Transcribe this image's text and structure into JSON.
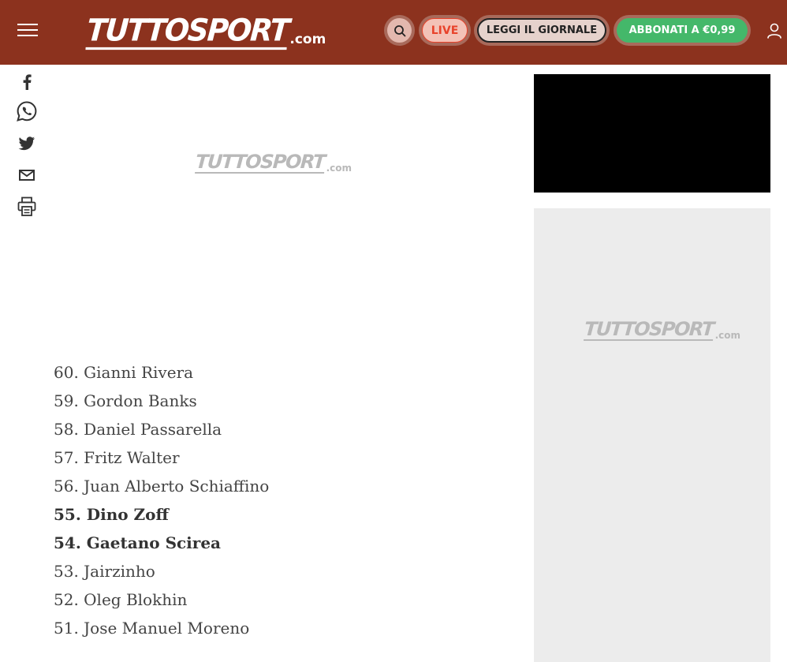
{
  "header": {
    "logo_main": "TUTTOSPORT",
    "logo_suffix": ".com",
    "live_label": "LIVE",
    "giornale_label": "LEGGI IL GIORNALE",
    "abbonati_label": "ABBONATI A €0,99"
  },
  "colors": {
    "header_bg": "#8c321e",
    "live_accent": "#e8432b",
    "subscribe_green": "#44b86a",
    "ad_background": "#ececec"
  },
  "share": {
    "icons": [
      "facebook-icon",
      "whatsapp-icon",
      "twitter-icon",
      "email-icon",
      "print-icon"
    ]
  },
  "placeholders": {
    "image_logo_main": "TUTTOSPORT",
    "image_logo_suffix": ".com",
    "ad_logo_main": "TUTTOSPORT",
    "ad_logo_suffix": ".com"
  },
  "ranking": [
    {
      "text": "60. Gianni Rivera",
      "bold": false
    },
    {
      "text": "59. Gordon Banks",
      "bold": false
    },
    {
      "text": "58. Daniel Passarella",
      "bold": false
    },
    {
      "text": "57. Fritz Walter",
      "bold": false
    },
    {
      "text": "56. Juan Alberto Schiaffino",
      "bold": false
    },
    {
      "text": "55. Dino Zoff",
      "bold": true
    },
    {
      "text": "54. Gaetano Scirea",
      "bold": true
    },
    {
      "text": "53. Jairzinho",
      "bold": false
    },
    {
      "text": "52. Oleg Blokhin",
      "bold": false
    },
    {
      "text": "51. Jose Manuel Moreno",
      "bold": false
    }
  ]
}
